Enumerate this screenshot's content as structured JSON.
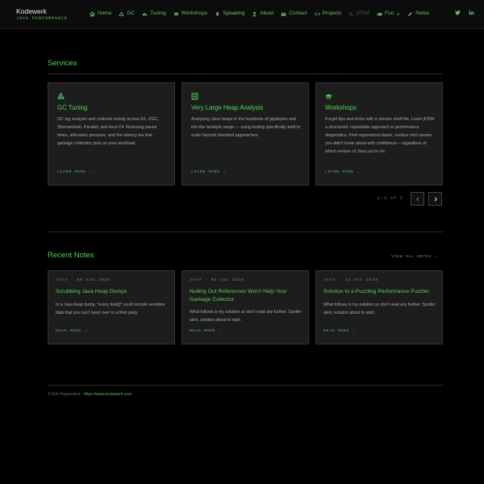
{
  "brand": {
    "title": "Kodewerk",
    "subtitle": "JAVA PERFORMANCE"
  },
  "nav": [
    {
      "label": "Home",
      "icon": "home-icon"
    },
    {
      "label": "GC",
      "icon": "recycle-icon"
    },
    {
      "label": "Tuning",
      "icon": "tachometer-icon"
    },
    {
      "label": "Workshops",
      "icon": "graduation-cap-icon"
    },
    {
      "label": "Speaking",
      "icon": "microphone-icon"
    },
    {
      "label": "About",
      "icon": "user-icon"
    },
    {
      "label": "Contact",
      "icon": "envelope-icon"
    },
    {
      "label": "Projects",
      "icon": "code-icon"
    },
    {
      "label": "jPDM",
      "icon": "stethoscope-icon"
    },
    {
      "label": "Fun",
      "icon": "gamepad-icon"
    },
    {
      "label": "Notes",
      "icon": "pencil-icon"
    }
  ],
  "social": [
    "twitter-icon",
    "linkedin-icon"
  ],
  "services": {
    "title": "Services",
    "items": [
      {
        "icon": "recycle-icon",
        "title": "GC Tuning",
        "description": "GC log analysis and collector tuning across G1, ZGC, Shenandoah, Parallel, and Azul C4. Reducing pause times, allocation pressure, and the latency tax that garbage collection puts on your workload.",
        "link": "LEARN MORE →"
      },
      {
        "icon": "database-icon",
        "title": "Very Large Heap Analysis",
        "description": "Analyzing Java heaps in the hundreds of gigabytes and into the terabyte range — using tooling specifically built to scale beyond standard approaches.",
        "link": "LEARN MORE →"
      },
      {
        "icon": "graduation-cap-icon",
        "title": "Workshops",
        "description": "Forget tips and tricks with a version shelf life. Learn jPDM: a structured, repeatable approach to performance diagnostics. Find regressions faster, surface root causes you didn't know about with confidence – regardless of which version of Java you're on.",
        "link": "LEARN MORE →"
      }
    ],
    "pager": "1–3 of 5"
  },
  "notes": {
    "title": "Recent Notes",
    "view_all": "VIEW ALL NOTES →",
    "items": [
      {
        "meta": "JAVA · 09 AUG 2026",
        "title": "Scrubbing Java Heap Dumps",
        "description": "In a Java heap dump, *every byte[]* could include sensitive data that you can't hand over to a third party.",
        "link": "READ MORE →"
      },
      {
        "meta": "JAVA · 05 JUL 2026",
        "title": "Nulling Out References Won't Help Your Garbage Collector",
        "description": "What follows is my solution so don't read any further. Spoiler alert, solution about to start.",
        "link": "READ MORE →"
      },
      {
        "meta": "JAVA · 13 OCT 2025",
        "title": "Solution to a Puzzling Performance Puzzler",
        "description": "What follows is my solution so don't read any further. Spoiler alert, solution about to start.",
        "link": "READ MORE →"
      }
    ]
  },
  "footer": {
    "copyright": "© Kirk Pepperdine · ",
    "url": "https://www.kodewerk.com"
  },
  "colors": {
    "accent": "#55d455",
    "background": "#000000",
    "card": "#1d1d1d"
  }
}
